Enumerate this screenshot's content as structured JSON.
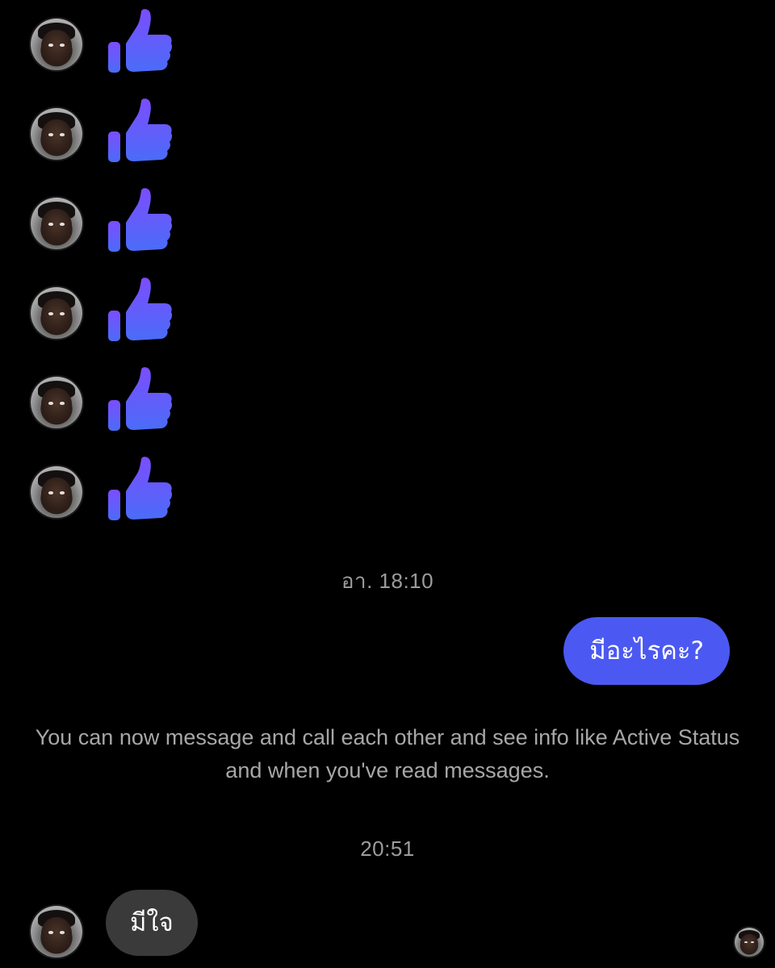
{
  "colors": {
    "background": "#000000",
    "like_gradient_top": "#7c4dff",
    "like_gradient_bottom": "#4a6cf7",
    "outgoing_bubble": "#4b59f2",
    "incoming_bubble": "#3a3a3a",
    "timestamp_text": "#9c9c9c",
    "system_text": "#a7a7a7"
  },
  "likes": [
    {
      "sender": "contact",
      "icon": "thumbs-up-icon"
    },
    {
      "sender": "contact",
      "icon": "thumbs-up-icon"
    },
    {
      "sender": "contact",
      "icon": "thumbs-up-icon"
    },
    {
      "sender": "contact",
      "icon": "thumbs-up-icon"
    },
    {
      "sender": "contact",
      "icon": "thumbs-up-icon"
    },
    {
      "sender": "contact",
      "icon": "thumbs-up-icon"
    }
  ],
  "timestamp_1": "อา. 18:10",
  "outgoing_message": "มีอะไรคะ?",
  "system_note": "You can now message and call each other and see info like Active Status and when you've read messages.",
  "timestamp_2": "20:51",
  "incoming_message": "มีใจ"
}
